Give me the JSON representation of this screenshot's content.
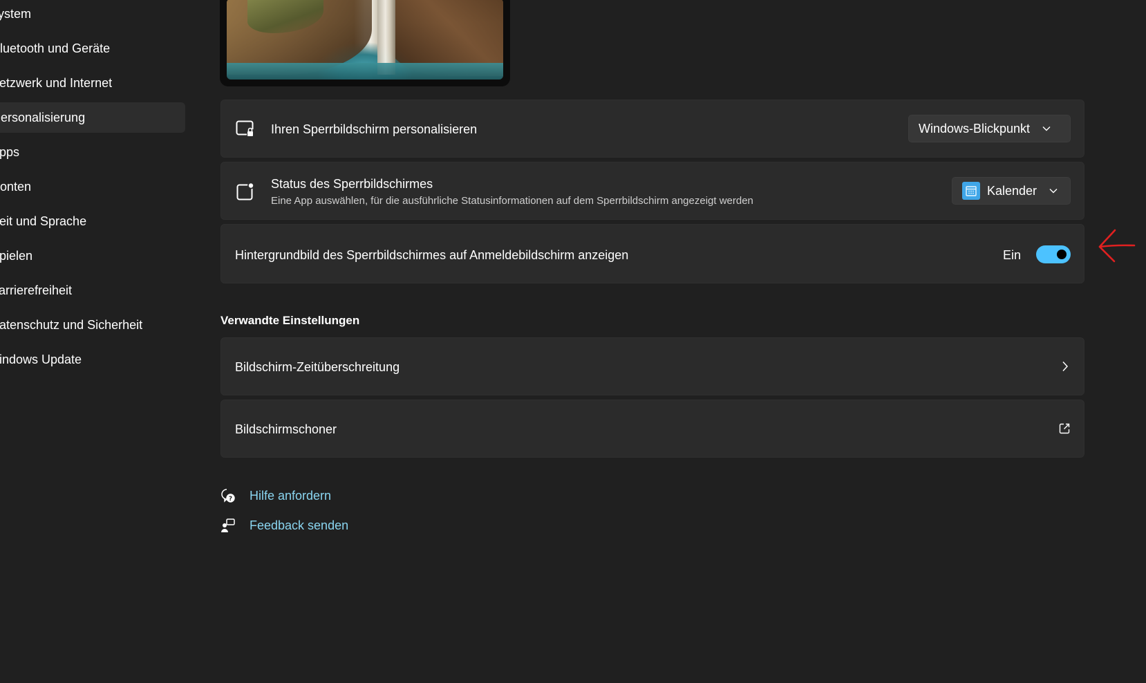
{
  "sidebar": {
    "items": [
      {
        "label": "System"
      },
      {
        "label": "Bluetooth und Geräte"
      },
      {
        "label": "Netzwerk und Internet"
      },
      {
        "label": "Personalisierung"
      },
      {
        "label": "Apps"
      },
      {
        "label": "Konten"
      },
      {
        "label": "Zeit und Sprache"
      },
      {
        "label": "Spielen"
      },
      {
        "label": "Barrierefreiheit"
      },
      {
        "label": "Datenschutz und Sicherheit"
      },
      {
        "label": "Windows Update"
      }
    ],
    "active_label": "Personalisierung"
  },
  "lock_screen": {
    "personalize": {
      "title": "Ihren Sperrbildschirm personalisieren",
      "selected": "Windows-Blickpunkt",
      "icon": "lock-screen-icon"
    },
    "status": {
      "title": "Status des Sperrbildschirmes",
      "subtitle": "Eine App auswählen, für die ausführliche Statusinformationen auf dem Sperrbildschirm angezeigt werden",
      "selected": "Kalender",
      "icon": "status-icon",
      "selected_icon": "calendar-icon"
    },
    "signin_background": {
      "title": "Hintergrundbild des Sperrbildschirmes auf Anmeldebildschirm anzeigen",
      "state_label": "Ein",
      "enabled": true
    }
  },
  "related": {
    "heading": "Verwandte Einstellungen",
    "items": [
      {
        "label": "Bildschirm-Zeitüberschreitung",
        "icon": "chevron-right-icon"
      },
      {
        "label": "Bildschirmschoner",
        "icon": "external-link-icon"
      }
    ]
  },
  "help_links": [
    {
      "label": "Hilfe anfordern",
      "icon": "help-icon"
    },
    {
      "label": "Feedback senden",
      "icon": "feedback-icon"
    }
  ],
  "colors": {
    "background": "#202020",
    "card": "#2b2b2b",
    "accent": "#4cc2ff",
    "link": "#8ad5f0",
    "annotation": "#e02020"
  }
}
